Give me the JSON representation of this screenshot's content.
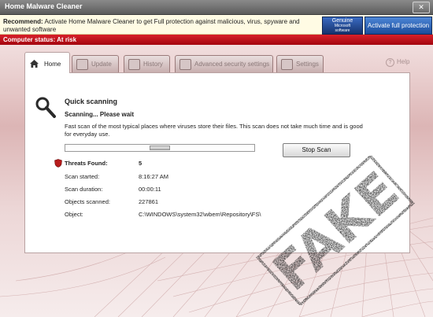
{
  "window": {
    "title": "Home Malware Cleaner",
    "close_glyph": "✕"
  },
  "notice": {
    "label": "Recommend:",
    "text": "Activate Home Malware Cleaner to get Full protection against malicious, virus, spyware and unwanted software"
  },
  "genuine": {
    "line1": "Genuine",
    "line2": "Microsoft",
    "line3": "software"
  },
  "activate_button": "Activate full protection",
  "status": {
    "text": "Computer status: At risk"
  },
  "tabs": [
    {
      "label": "Home",
      "icon": "home-icon",
      "active": true
    },
    {
      "label": "Update",
      "icon": "update-icon",
      "active": false
    },
    {
      "label": "History",
      "icon": "history-icon",
      "active": false
    },
    {
      "label": "Advanced security settings",
      "icon": "wrench-icon",
      "active": false
    },
    {
      "label": "Settings",
      "icon": "gear-icon",
      "active": false
    }
  ],
  "help": {
    "label": "Help",
    "icon": "help-icon",
    "glyph": "?"
  },
  "scan": {
    "title": "Quick scanning",
    "status": "Scanning... Please wait",
    "description": "Fast scan of the most typical places where viruses store their files. This scan does not take much time and is good for everyday use.",
    "progress": 0.5,
    "stop_button": "Stop Scan",
    "fields": [
      {
        "label": "Threats Found:",
        "value": "5"
      },
      {
        "label": "Scan started:",
        "value": "8:16:27 AM"
      },
      {
        "label": "Scan duration:",
        "value": "00:00:11"
      },
      {
        "label": "Objects scanned:",
        "value": "227861"
      },
      {
        "label": "Object:",
        "value": "C:\\WINDOWS\\system32\\wbem\\Repository\\FS\\"
      }
    ]
  },
  "stamp": {
    "text": "FAKE",
    "color": "#1a1a1a"
  },
  "colors": {
    "accent_red": "#c0111b",
    "notice_bg": "#fffbe4",
    "activate_blue": "#2a5fb0"
  }
}
